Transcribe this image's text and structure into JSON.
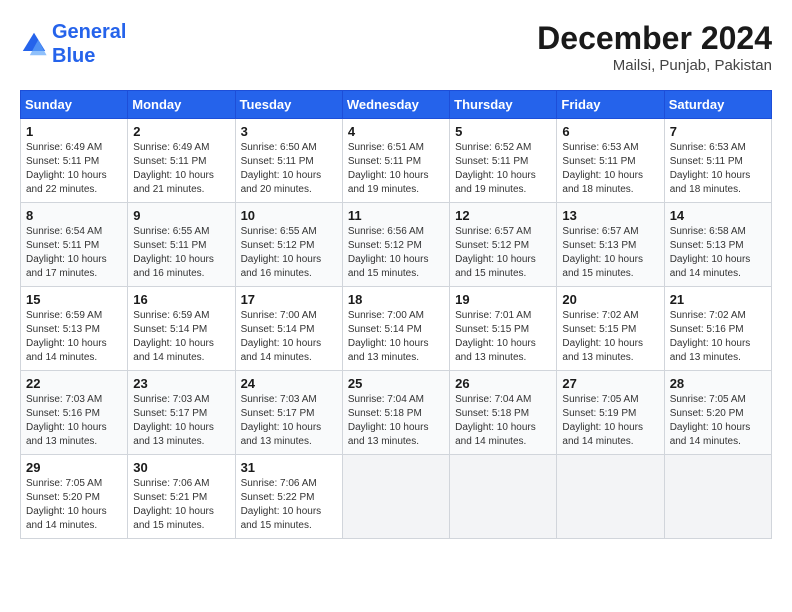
{
  "header": {
    "logo_line1": "General",
    "logo_line2": "Blue",
    "month": "December 2024",
    "location": "Mailsi, Punjab, Pakistan"
  },
  "weekdays": [
    "Sunday",
    "Monday",
    "Tuesday",
    "Wednesday",
    "Thursday",
    "Friday",
    "Saturday"
  ],
  "weeks": [
    [
      {
        "day": "1",
        "sunrise": "Sunrise: 6:49 AM",
        "sunset": "Sunset: 5:11 PM",
        "daylight": "Daylight: 10 hours and 22 minutes."
      },
      {
        "day": "2",
        "sunrise": "Sunrise: 6:49 AM",
        "sunset": "Sunset: 5:11 PM",
        "daylight": "Daylight: 10 hours and 21 minutes."
      },
      {
        "day": "3",
        "sunrise": "Sunrise: 6:50 AM",
        "sunset": "Sunset: 5:11 PM",
        "daylight": "Daylight: 10 hours and 20 minutes."
      },
      {
        "day": "4",
        "sunrise": "Sunrise: 6:51 AM",
        "sunset": "Sunset: 5:11 PM",
        "daylight": "Daylight: 10 hours and 19 minutes."
      },
      {
        "day": "5",
        "sunrise": "Sunrise: 6:52 AM",
        "sunset": "Sunset: 5:11 PM",
        "daylight": "Daylight: 10 hours and 19 minutes."
      },
      {
        "day": "6",
        "sunrise": "Sunrise: 6:53 AM",
        "sunset": "Sunset: 5:11 PM",
        "daylight": "Daylight: 10 hours and 18 minutes."
      },
      {
        "day": "7",
        "sunrise": "Sunrise: 6:53 AM",
        "sunset": "Sunset: 5:11 PM",
        "daylight": "Daylight: 10 hours and 18 minutes."
      }
    ],
    [
      {
        "day": "8",
        "sunrise": "Sunrise: 6:54 AM",
        "sunset": "Sunset: 5:11 PM",
        "daylight": "Daylight: 10 hours and 17 minutes."
      },
      {
        "day": "9",
        "sunrise": "Sunrise: 6:55 AM",
        "sunset": "Sunset: 5:11 PM",
        "daylight": "Daylight: 10 hours and 16 minutes."
      },
      {
        "day": "10",
        "sunrise": "Sunrise: 6:55 AM",
        "sunset": "Sunset: 5:12 PM",
        "daylight": "Daylight: 10 hours and 16 minutes."
      },
      {
        "day": "11",
        "sunrise": "Sunrise: 6:56 AM",
        "sunset": "Sunset: 5:12 PM",
        "daylight": "Daylight: 10 hours and 15 minutes."
      },
      {
        "day": "12",
        "sunrise": "Sunrise: 6:57 AM",
        "sunset": "Sunset: 5:12 PM",
        "daylight": "Daylight: 10 hours and 15 minutes."
      },
      {
        "day": "13",
        "sunrise": "Sunrise: 6:57 AM",
        "sunset": "Sunset: 5:13 PM",
        "daylight": "Daylight: 10 hours and 15 minutes."
      },
      {
        "day": "14",
        "sunrise": "Sunrise: 6:58 AM",
        "sunset": "Sunset: 5:13 PM",
        "daylight": "Daylight: 10 hours and 14 minutes."
      }
    ],
    [
      {
        "day": "15",
        "sunrise": "Sunrise: 6:59 AM",
        "sunset": "Sunset: 5:13 PM",
        "daylight": "Daylight: 10 hours and 14 minutes."
      },
      {
        "day": "16",
        "sunrise": "Sunrise: 6:59 AM",
        "sunset": "Sunset: 5:14 PM",
        "daylight": "Daylight: 10 hours and 14 minutes."
      },
      {
        "day": "17",
        "sunrise": "Sunrise: 7:00 AM",
        "sunset": "Sunset: 5:14 PM",
        "daylight": "Daylight: 10 hours and 14 minutes."
      },
      {
        "day": "18",
        "sunrise": "Sunrise: 7:00 AM",
        "sunset": "Sunset: 5:14 PM",
        "daylight": "Daylight: 10 hours and 13 minutes."
      },
      {
        "day": "19",
        "sunrise": "Sunrise: 7:01 AM",
        "sunset": "Sunset: 5:15 PM",
        "daylight": "Daylight: 10 hours and 13 minutes."
      },
      {
        "day": "20",
        "sunrise": "Sunrise: 7:02 AM",
        "sunset": "Sunset: 5:15 PM",
        "daylight": "Daylight: 10 hours and 13 minutes."
      },
      {
        "day": "21",
        "sunrise": "Sunrise: 7:02 AM",
        "sunset": "Sunset: 5:16 PM",
        "daylight": "Daylight: 10 hours and 13 minutes."
      }
    ],
    [
      {
        "day": "22",
        "sunrise": "Sunrise: 7:03 AM",
        "sunset": "Sunset: 5:16 PM",
        "daylight": "Daylight: 10 hours and 13 minutes."
      },
      {
        "day": "23",
        "sunrise": "Sunrise: 7:03 AM",
        "sunset": "Sunset: 5:17 PM",
        "daylight": "Daylight: 10 hours and 13 minutes."
      },
      {
        "day": "24",
        "sunrise": "Sunrise: 7:03 AM",
        "sunset": "Sunset: 5:17 PM",
        "daylight": "Daylight: 10 hours and 13 minutes."
      },
      {
        "day": "25",
        "sunrise": "Sunrise: 7:04 AM",
        "sunset": "Sunset: 5:18 PM",
        "daylight": "Daylight: 10 hours and 13 minutes."
      },
      {
        "day": "26",
        "sunrise": "Sunrise: 7:04 AM",
        "sunset": "Sunset: 5:18 PM",
        "daylight": "Daylight: 10 hours and 14 minutes."
      },
      {
        "day": "27",
        "sunrise": "Sunrise: 7:05 AM",
        "sunset": "Sunset: 5:19 PM",
        "daylight": "Daylight: 10 hours and 14 minutes."
      },
      {
        "day": "28",
        "sunrise": "Sunrise: 7:05 AM",
        "sunset": "Sunset: 5:20 PM",
        "daylight": "Daylight: 10 hours and 14 minutes."
      }
    ],
    [
      {
        "day": "29",
        "sunrise": "Sunrise: 7:05 AM",
        "sunset": "Sunset: 5:20 PM",
        "daylight": "Daylight: 10 hours and 14 minutes."
      },
      {
        "day": "30",
        "sunrise": "Sunrise: 7:06 AM",
        "sunset": "Sunset: 5:21 PM",
        "daylight": "Daylight: 10 hours and 15 minutes."
      },
      {
        "day": "31",
        "sunrise": "Sunrise: 7:06 AM",
        "sunset": "Sunset: 5:22 PM",
        "daylight": "Daylight: 10 hours and 15 minutes."
      },
      null,
      null,
      null,
      null
    ]
  ]
}
